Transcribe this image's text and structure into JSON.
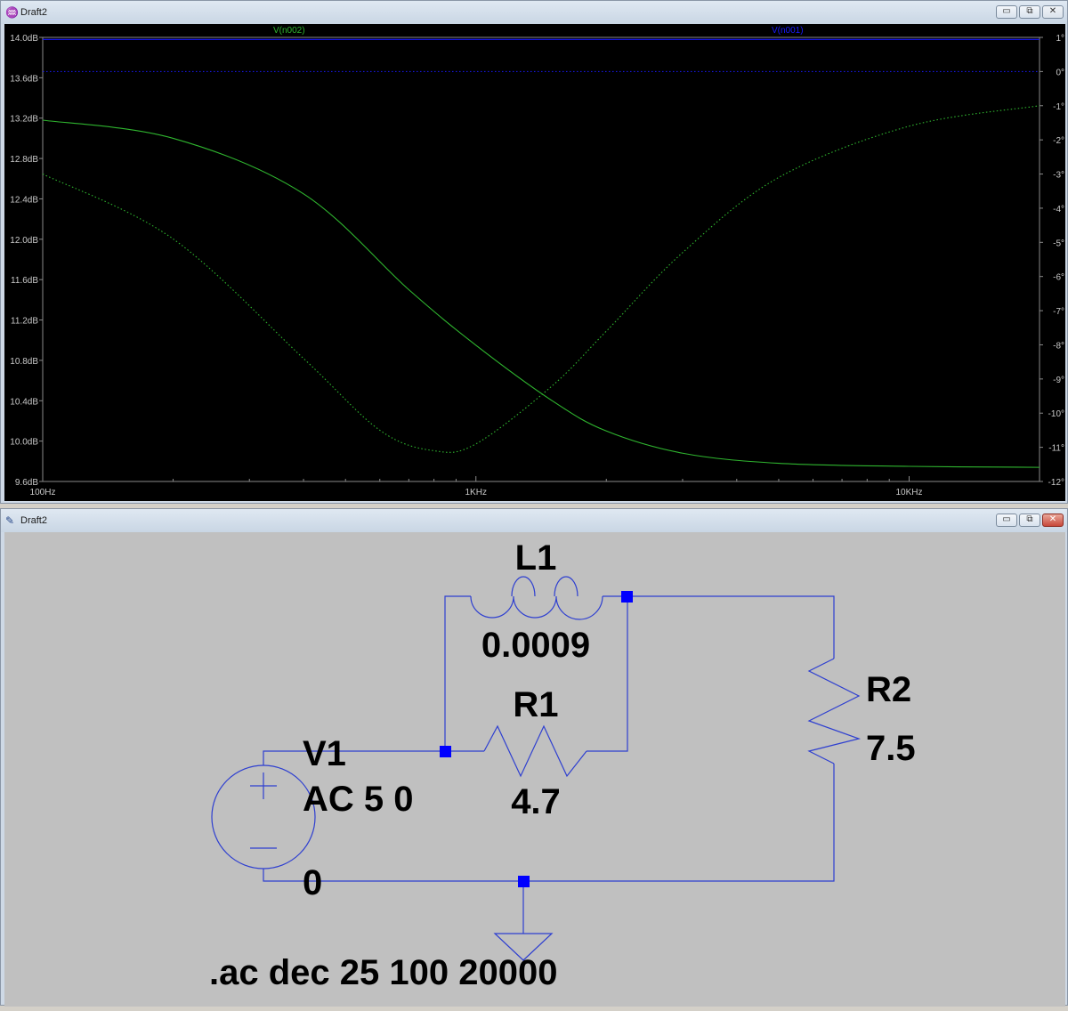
{
  "plot_window": {
    "title": "Draft2",
    "icon": "waveform-icon",
    "controls": {
      "minimize": "▭",
      "restore": "⧉",
      "close": "✕"
    }
  },
  "schematic_window": {
    "title": "Draft2",
    "icon": "schematic-icon",
    "controls": {
      "minimize": "▭",
      "restore": "⧉",
      "close": "✕"
    }
  },
  "colors": {
    "plot_bg": "#000000",
    "trace_green": "#2fb52f",
    "trace_blue": "#1a1aff",
    "axis_text": "#c8c8c8",
    "wire": "#2e3fd0",
    "node": "#0000ff",
    "schematic_bg": "#c0c0c0"
  },
  "chart_data": {
    "type": "line",
    "x_scale": "log",
    "xlim": [
      100,
      20000
    ],
    "y_left_lim": [
      9.6,
      14.0
    ],
    "y_right_lim": [
      -12,
      1
    ],
    "left_ticks": [
      "14.0dB",
      "13.6dB",
      "13.2dB",
      "12.8dB",
      "12.4dB",
      "12.0dB",
      "11.6dB",
      "11.2dB",
      "10.8dB",
      "10.4dB",
      "10.0dB",
      "9.6dB"
    ],
    "left_tick_values": [
      14.0,
      13.6,
      13.2,
      12.8,
      12.4,
      12.0,
      11.6,
      11.2,
      10.8,
      10.4,
      10.0,
      9.6
    ],
    "right_ticks": [
      "1°",
      "0°",
      "-1°",
      "-2°",
      "-3°",
      "-4°",
      "-5°",
      "-6°",
      "-7°",
      "-8°",
      "-9°",
      "-10°",
      "-11°",
      "-12°"
    ],
    "right_tick_values": [
      1,
      0,
      -1,
      -2,
      -3,
      -4,
      -5,
      -6,
      -7,
      -8,
      -9,
      -10,
      -11,
      -12
    ],
    "x_ticks": [
      "100Hz",
      "1KHz",
      "10KHz"
    ],
    "x_tick_values": [
      100,
      1000,
      10000
    ],
    "series": [
      {
        "name": "V(n002)",
        "kind": "magnitude",
        "x": [
          100,
          200,
          400,
          700,
          1000,
          1500,
          2000,
          3000,
          5000,
          10000,
          20000
        ],
        "y": [
          13.18,
          13.0,
          12.45,
          11.5,
          10.95,
          10.4,
          10.1,
          9.88,
          9.78,
          9.75,
          9.74
        ]
      },
      {
        "name": "V(n002)",
        "kind": "phase",
        "x": [
          100,
          200,
          400,
          600,
          800,
          1000,
          1500,
          2000,
          3000,
          5000,
          10000,
          20000
        ],
        "y": [
          -3.0,
          -4.9,
          -8.4,
          -10.5,
          -11.1,
          -10.9,
          -9.2,
          -7.6,
          -5.3,
          -3.1,
          -1.6,
          -1.0
        ]
      },
      {
        "name": "V(n001)",
        "kind": "magnitude",
        "x": [
          100,
          20000
        ],
        "y": [
          13.98,
          13.98
        ]
      },
      {
        "name": "V(n001)",
        "kind": "phase",
        "x": [
          100,
          20000
        ],
        "y": [
          0,
          0
        ]
      }
    ]
  },
  "schematic": {
    "L1": {
      "name": "L1",
      "value": "0.0009"
    },
    "R1": {
      "name": "R1",
      "value": "4.7"
    },
    "R2": {
      "name": "R2",
      "value": "7.5"
    },
    "V1": {
      "name": "V1",
      "value": "AC 5 0"
    },
    "ground_label": "0",
    "directive": ".ac dec 25 100 20000"
  }
}
